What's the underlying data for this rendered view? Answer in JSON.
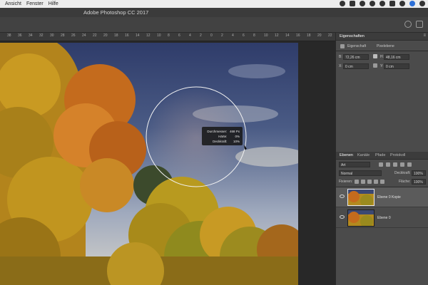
{
  "menubar": {
    "items": [
      "Ansicht",
      "Fenster",
      "Hilfe"
    ],
    "tray_icons": [
      "cloud-icon",
      "record-icon",
      "flux-icon",
      "info-icon",
      "wifi-icon",
      "battery-icon",
      "search-icon",
      "siri-icon",
      "control-center-icon"
    ]
  },
  "app": {
    "title": "Adobe Photoshop CC 2017"
  },
  "ruler": {
    "ticks": [
      "38",
      "36",
      "34",
      "32",
      "30",
      "28",
      "26",
      "24",
      "22",
      "20",
      "18",
      "16",
      "14",
      "12",
      "10",
      "8",
      "6",
      "4",
      "2",
      "0",
      "2",
      "4",
      "6",
      "8",
      "10",
      "12",
      "14",
      "16",
      "18",
      "20",
      "22"
    ]
  },
  "brush_hud": {
    "rows": [
      {
        "label": "Durchmesser:",
        "value": "468 Px"
      },
      {
        "label": "Härte:",
        "value": "0%"
      },
      {
        "label": "Deckkraft:",
        "value": "10%"
      }
    ]
  },
  "properties_panel": {
    "title": "Eigenschaften",
    "tab_a": "Eigenschaft",
    "tab_b": "Pixelebene",
    "w_label": "B:",
    "w_value": "72,26 cm",
    "h_label": "H:",
    "h_value": "48,16 cm",
    "x_label": "X:",
    "x_value": "0 cm",
    "y_label": "Y:",
    "y_value": "0 cm"
  },
  "layers_panel": {
    "tabs": [
      "Ebenen",
      "Kanäle",
      "Pfade",
      "Protokoll"
    ],
    "filter_label": "Art",
    "blend_mode": "Normal",
    "opacity_label": "Deckkraft:",
    "opacity_value": "100%",
    "lock_label": "Fixieren:",
    "fill_label": "Fläche:",
    "fill_value": "100%",
    "layers": [
      {
        "name": "Ebene 0 Kopie",
        "selected": true
      },
      {
        "name": "Ebene 0",
        "selected": false
      }
    ]
  },
  "colors": {
    "accent": "#2d6fd6",
    "panel": "#4b4b4b"
  }
}
